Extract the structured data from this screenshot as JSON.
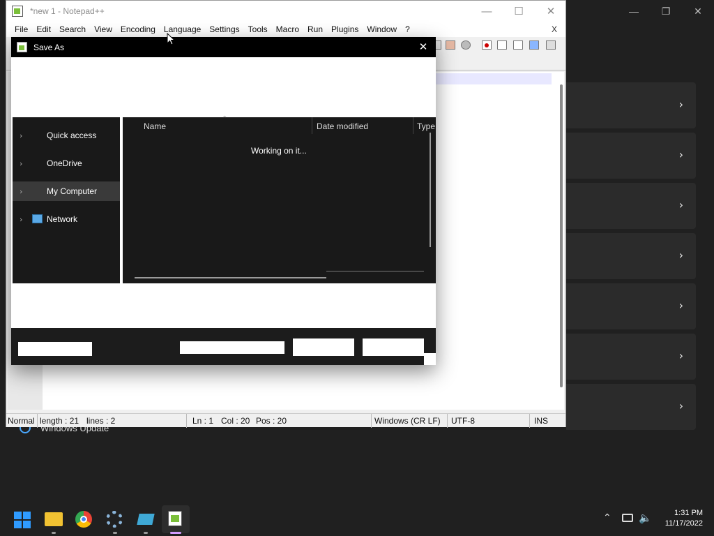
{
  "notepad": {
    "title": "*new 1 - Notepad++",
    "menu": [
      "File",
      "Edit",
      "Search",
      "View",
      "Encoding",
      "Language",
      "Settings",
      "Tools",
      "Macro",
      "Run",
      "Plugins",
      "Window",
      "?"
    ],
    "menu_close": "X",
    "status": {
      "mode": "Normal",
      "length": "length : 21",
      "lines": "lines : 2",
      "ln": "Ln : 1",
      "col": "Col : 20",
      "pos": "Pos : 20",
      "eol": "Windows (CR LF)",
      "encoding": "UTF-8",
      "ins": "INS"
    }
  },
  "dialog": {
    "title": "Save As",
    "nav": [
      {
        "label": "Quick access"
      },
      {
        "label": "OneDrive"
      },
      {
        "label": "My Computer",
        "selected": true
      },
      {
        "label": "Network"
      }
    ],
    "columns": [
      "Name",
      "Date modified",
      "Type"
    ],
    "status_text": "Working on it..."
  },
  "background": {
    "windows_update": "Windows Update"
  },
  "taskbar": {
    "time": "1:31 PM",
    "date": "11/17/2022"
  },
  "colors": {
    "dialog_title_bg": "#000000",
    "pane_bg": "#191919",
    "taskbar_bg": "#202020"
  }
}
